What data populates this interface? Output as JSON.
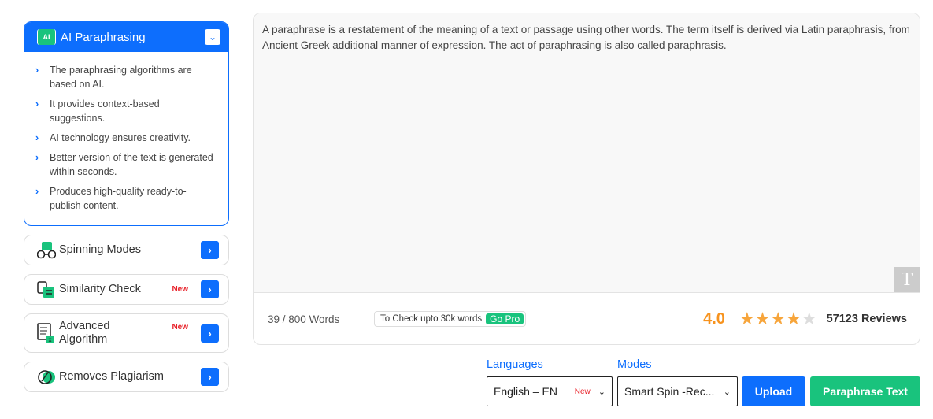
{
  "sidebar": {
    "accordion": {
      "title": "AI Paraphrasing",
      "chip": "AI",
      "items": [
        "The paraphrasing algorithms are based on AI.",
        "It provides context-based suggestions.",
        "AI technology ensures creativity.",
        "Better version of the text is generated within seconds.",
        "Produces high-quality ready-to-publish content."
      ]
    },
    "cards": [
      {
        "label": "Spinning Modes",
        "icon": "spinning-modes-icon",
        "badge": ""
      },
      {
        "label": "Similarity Check",
        "icon": "similarity-check-icon",
        "badge": "New"
      },
      {
        "label": "Advanced Algorithm",
        "icon": "advanced-algorithm-icon",
        "badge": "New"
      },
      {
        "label": "Removes Plagiarism",
        "icon": "removes-plagiarism-icon",
        "badge": ""
      }
    ]
  },
  "editor": {
    "text": "A paraphrase is a restatement of the meaning of a text or passage using other words. The term itself is derived via Latin paraphrasis, from Ancient Greek additional manner of expression. The act of paraphrasing is also called paraphrasis.",
    "badge": "T",
    "word_count": "39 / 800 Words",
    "pro_text": "To Check upto 30k words",
    "pro_button": "Go Pro",
    "rating": "4.0",
    "stars": 4,
    "reviews": "57123 Reviews"
  },
  "controls": {
    "languages_label": "Languages",
    "language_value": "English – EN",
    "language_badge": "New",
    "modes_label": "Modes",
    "mode_value": "Smart Spin -Rec...",
    "upload": "Upload",
    "paraphrase": "Paraphrase Text"
  },
  "colors": {
    "primary": "#0d6efd",
    "green": "#19c37d",
    "star": "#f7a53b",
    "new": "#e8232b"
  }
}
